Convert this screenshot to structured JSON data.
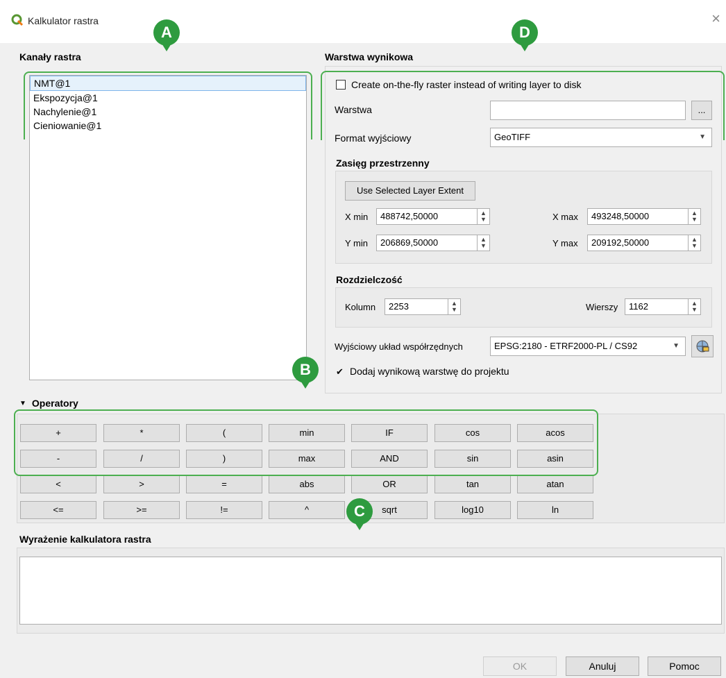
{
  "window": {
    "title": "Kalkulator rastra",
    "close": "×"
  },
  "bands": {
    "title": "Kanały rastra",
    "items": [
      "NMT@1",
      "Ekspozycja@1",
      "Nachylenie@1",
      "Cieniowanie@1"
    ]
  },
  "result": {
    "title": "Warstwa wynikowa",
    "onthefly_label": "Create on-the-fly raster instead of writing layer to disk",
    "layer_label": "Warstwa",
    "layer_value": "",
    "browse": "...",
    "format_label": "Format wyjściowy",
    "format_value": "GeoTIFF",
    "extent": {
      "title": "Zasięg przestrzenny",
      "use_selected": "Use Selected Layer Extent",
      "xmin_label": "X min",
      "xmin": "488742,50000",
      "xmax_label": "X max",
      "xmax": "493248,50000",
      "ymin_label": "Y min",
      "ymin": "206869,50000",
      "ymax_label": "Y max",
      "ymax": "209192,50000"
    },
    "resolution": {
      "title": "Rozdzielczość",
      "cols_label": "Kolumn",
      "cols": "2253",
      "rows_label": "Wierszy",
      "rows": "1162"
    },
    "crs_label": "Wyjściowy układ współrzędnych",
    "crs_value": "EPSG:2180 - ETRF2000-PL / CS92",
    "add_to_project": "Dodaj wynikową warstwę do projektu"
  },
  "operators": {
    "title": "Operatory",
    "rows": [
      [
        "+",
        "*",
        "(",
        "min",
        "IF",
        "cos",
        "acos"
      ],
      [
        "-",
        "/",
        ")",
        "max",
        "AND",
        "sin",
        "asin"
      ],
      [
        "<",
        ">",
        "=",
        "abs",
        "OR",
        "tan",
        "atan"
      ],
      [
        "<=",
        ">=",
        "!=",
        "^",
        "sqrt",
        "log10",
        "ln"
      ]
    ]
  },
  "expression": {
    "title": "Wyrażenie kalkulatora rastra",
    "value": ""
  },
  "footer": {
    "ok": "OK",
    "cancel": "Anuluj",
    "help": "Pomoc"
  },
  "callouts": {
    "a": "A",
    "b": "B",
    "c": "C",
    "d": "D"
  },
  "colors": {
    "callout": "#2e9b3f",
    "highlight": "#4caf50"
  }
}
